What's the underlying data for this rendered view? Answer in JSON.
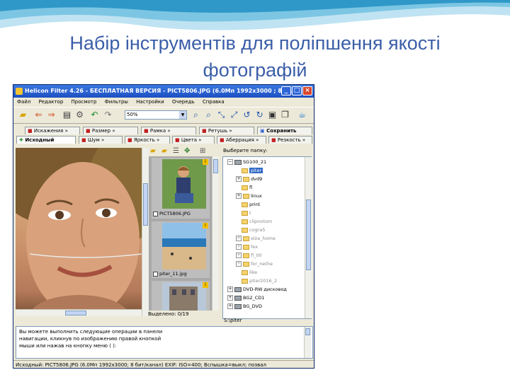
{
  "slide": {
    "title_line1": "Набір інструментів для поліпшення якості",
    "title_line2": "фотографій"
  },
  "window": {
    "title": "Helicon Filter 4.26 - БЕСПЛАТНАЯ ВЕРСИЯ - PICT5806.JPG (6.0Мп 1992x3000 ; 8 б...",
    "controls": {
      "minimize": "_",
      "maximize": "□",
      "close": "×"
    }
  },
  "menu": [
    "Файл",
    "Редактор",
    "Просмотр",
    "Фильтры",
    "Настройки",
    "Очередь",
    "Справка"
  ],
  "toolbar": {
    "zoom_value": "50%",
    "icons": [
      "folder-open-icon",
      "arrow-back-icon",
      "arrow-forward-icon",
      "print-icon",
      "batch-icon",
      "undo-icon",
      "zoom-in-icon",
      "zoom-out-icon",
      "fit-icon",
      "actual-size-icon",
      "rotate-left-icon",
      "rotate-right-icon",
      "compare-icon",
      "copy-icon",
      "help-icon"
    ]
  },
  "tabs_row1": [
    "Искажения »",
    "Размер »",
    "Рамка »",
    "Ретушь »",
    "Сохранить"
  ],
  "tabs_row2": [
    "Исходный",
    "Шум »",
    "Яркость »",
    "Цвета »",
    "Аберрация »",
    "Резкость »"
  ],
  "browser": {
    "thumbnails": [
      {
        "name": "PICT5806.JPG"
      },
      {
        "name": "PICT5806.JPG"
      },
      {
        "name": "piter_11.jpg"
      }
    ],
    "selected_count": "Выделено: 0/19",
    "folder_label": "Выберите папку:",
    "tree": [
      {
        "label": "SG100_21",
        "type": "drive"
      },
      {
        "label": "piter",
        "type": "folder",
        "selected": true
      },
      {
        "label": "dvd9",
        "type": "folder"
      },
      {
        "label": "fl",
        "type": "folder"
      },
      {
        "label": "linux",
        "type": "folder"
      },
      {
        "label": "print",
        "type": "folder"
      },
      {
        "label": "t",
        "type": "folder",
        "dim": true
      },
      {
        "label": "clipnotom",
        "type": "folder",
        "dim": true
      },
      {
        "label": "cogra5",
        "type": "folder",
        "dim": true
      },
      {
        "label": "elza_home",
        "type": "folder",
        "dim": true
      },
      {
        "label": "fex",
        "type": "folder",
        "dim": true
      },
      {
        "label": "fl_00",
        "type": "folder",
        "dim": true
      },
      {
        "label": "for_nethe",
        "type": "folder",
        "dim": true
      },
      {
        "label": "like",
        "type": "folder",
        "dim": true
      },
      {
        "label": "piter2016_2",
        "type": "folder",
        "dim": true
      },
      {
        "label": "DVD-RW дисковод",
        "type": "drive"
      },
      {
        "label": "BG2_CD1",
        "type": "drive"
      },
      {
        "label": "BG_DVD",
        "type": "drive"
      }
    ],
    "path": "S:\\piter"
  },
  "info_text": [
    "Вы можете выполнить следующие операции в панели",
    "навигации, кликнув по изображению правой кнопкой",
    "мыши или нажав на кнопку меню (     ):"
  ],
  "status_bar": "Исходный: PICT5806.JPG (6.0Мп 1992x3000; 8 бит/канал)  EXIF: ISO=400; Вспышка=выкл; позвал"
}
